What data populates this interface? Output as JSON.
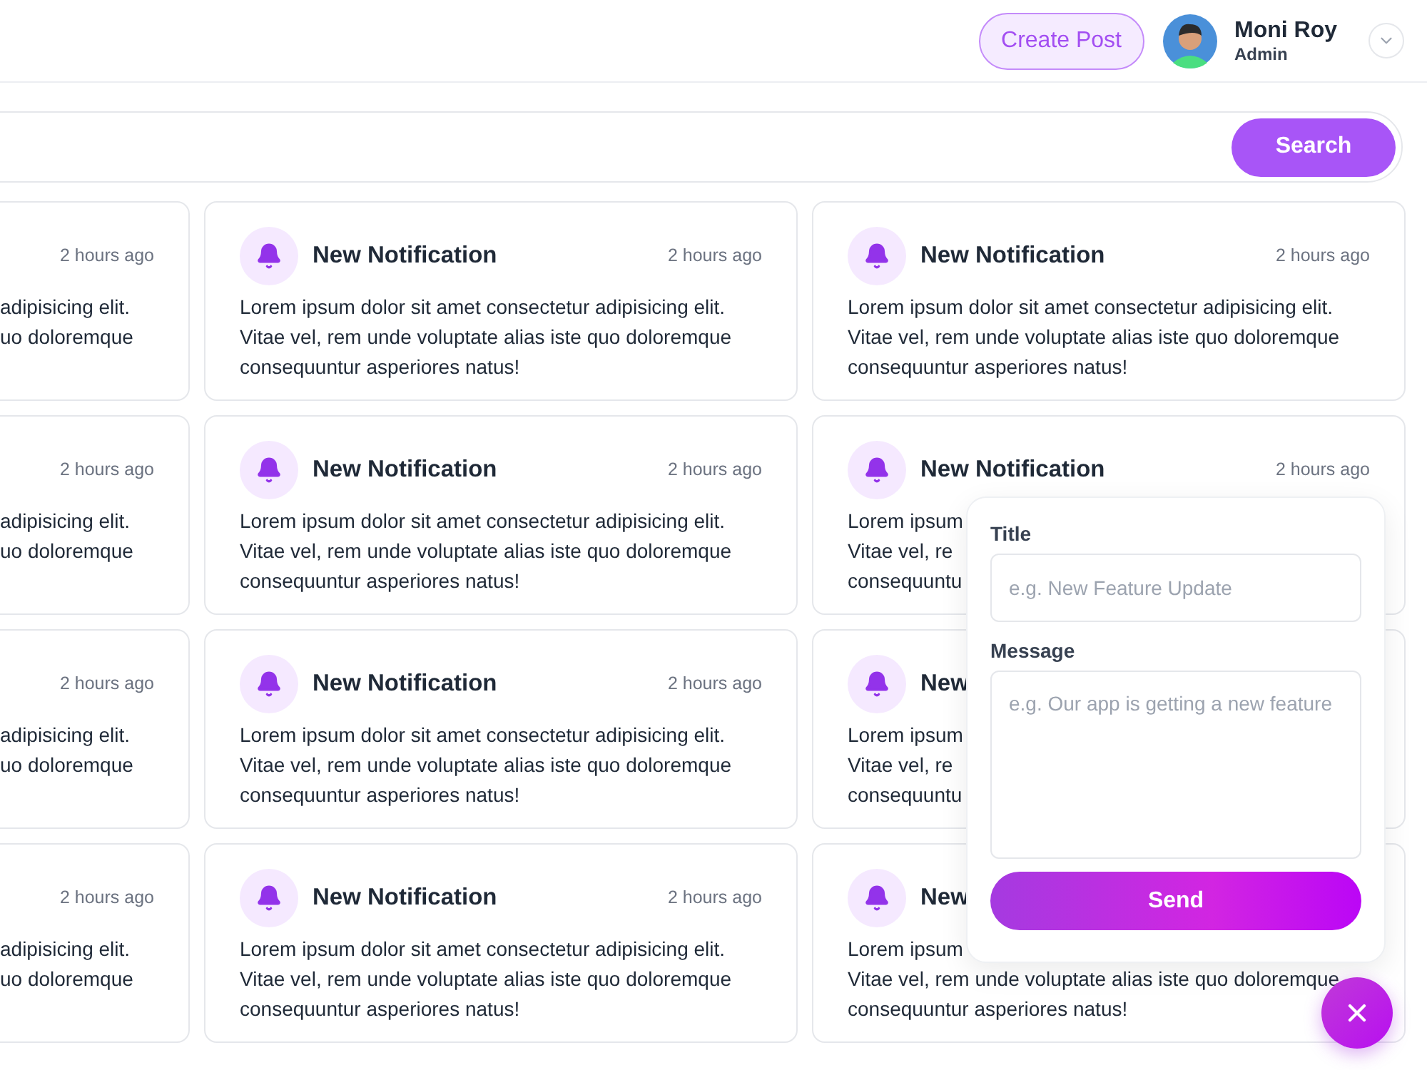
{
  "header": {
    "create_button": "Create Post",
    "user": {
      "name": "Moni Roy",
      "role": "Admin"
    }
  },
  "search": {
    "button": "Search"
  },
  "cards": [
    {
      "time": "2 hours ago",
      "lines": [
        "adipisicing elit.",
        "uo doloremque"
      ]
    },
    {
      "title": "New Notification",
      "time": "2 hours ago",
      "lines": [
        "Lorem ipsum dolor sit amet consectetur adipisicing elit.",
        "Vitae vel, rem unde voluptate alias iste quo doloremque",
        "consequuntur asperiores natus!"
      ]
    },
    {
      "title": "New Notification",
      "time": "2 hours ago",
      "lines": [
        "Lorem ipsum dolor sit amet consectetur adipisicing elit.",
        "Vitae vel, rem unde voluptate alias iste quo doloremque",
        "consequuntur asperiores natus!"
      ]
    },
    {
      "time": "2 hours ago",
      "lines": [
        "adipisicing elit.",
        "uo doloremque"
      ]
    },
    {
      "title": "New Notification",
      "time": "2 hours ago",
      "lines": [
        "Lorem ipsum dolor sit amet consectetur adipisicing elit.",
        "Vitae vel, rem unde voluptate alias iste quo doloremque",
        "consequuntur asperiores natus!"
      ]
    },
    {
      "title": "New Notification",
      "time": "2 hours ago",
      "lines": [
        "Lorem ipsum",
        "Vitae vel, re",
        "consequuntu"
      ]
    },
    {
      "time": "2 hours ago",
      "lines": [
        "adipisicing elit.",
        "uo doloremque"
      ]
    },
    {
      "title": "New Notification",
      "time": "2 hours ago",
      "lines": [
        "Lorem ipsum dolor sit amet consectetur adipisicing elit.",
        "Vitae vel, rem unde voluptate alias iste quo doloremque",
        "consequuntur asperiores natus!"
      ]
    },
    {
      "title": "New",
      "lines": [
        "Lorem ipsum",
        "Vitae vel, re",
        "consequuntu"
      ]
    },
    {
      "time": "2 hours ago",
      "lines": [
        "adipisicing elit.",
        "uo doloremque"
      ]
    },
    {
      "title": "New Notification",
      "time": "2 hours ago",
      "lines": [
        "Lorem ipsum dolor sit amet consectetur adipisicing elit.",
        "Vitae vel, rem unde voluptate alias iste quo doloremque",
        "consequuntur asperiores natus!"
      ]
    },
    {
      "title": "New",
      "lines": [
        "Lorem ipsum",
        "Vitae vel, rem unde voluptate alias iste quo doloremque",
        "consequuntur asperiores natus!"
      ]
    }
  ],
  "form": {
    "title_label": "Title",
    "title_placeholder": "e.g. New Feature Update",
    "message_label": "Message",
    "message_placeholder": "e.g. Our app is getting a new feature",
    "send_button": "Send"
  }
}
